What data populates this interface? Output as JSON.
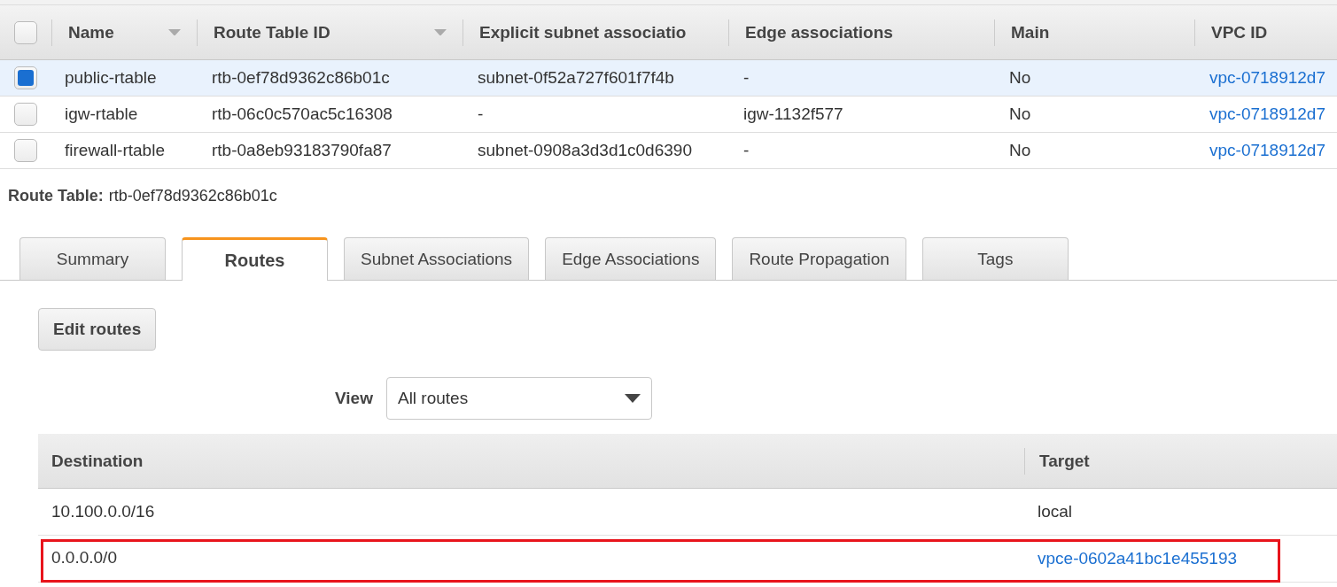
{
  "route_tables": {
    "select_all": {
      "checked": false
    },
    "columns": [
      {
        "label": "Name",
        "sortable": true
      },
      {
        "label": "Route Table ID",
        "sortable": true
      },
      {
        "label": "Explicit subnet associatio",
        "sortable": false
      },
      {
        "label": "Edge associations",
        "sortable": false
      },
      {
        "label": "Main",
        "sortable": false
      },
      {
        "label": "VPC ID",
        "sortable": false
      }
    ],
    "rows": [
      {
        "selected": true,
        "cells": [
          "public-rtable",
          "rtb-0ef78d9362c86b01c",
          "subnet-0f52a727f601f7f4b",
          "-",
          "No",
          "vpc-0718912d7"
        ]
      },
      {
        "selected": false,
        "cells": [
          "igw-rtable",
          "rtb-06c0c570ac5c16308",
          "-",
          "igw-1132f577",
          "No",
          "vpc-0718912d7"
        ]
      },
      {
        "selected": false,
        "cells": [
          "firewall-rtable",
          "rtb-0a8eb93183790fa87",
          "subnet-0908a3d3d1c0d6390",
          "-",
          "No",
          "vpc-0718912d7"
        ]
      }
    ]
  },
  "detail": {
    "label": "Route Table:",
    "value": "rtb-0ef78d9362c86b01c"
  },
  "tabs": [
    {
      "label": "Summary",
      "selected": false
    },
    {
      "label": "Routes",
      "selected": true
    },
    {
      "label": "Subnet Associations",
      "selected": false
    },
    {
      "label": "Edge Associations",
      "selected": false
    },
    {
      "label": "Route Propagation",
      "selected": false
    },
    {
      "label": "Tags",
      "selected": false
    }
  ],
  "edit_button": "Edit routes",
  "view": {
    "label": "View",
    "value": "All routes"
  },
  "routes": {
    "columns": [
      "Destination",
      "Target"
    ],
    "rows": [
      {
        "destination": "10.100.0.0/16",
        "target": "local",
        "target_link": false,
        "highlighted": false
      },
      {
        "destination": "0.0.0.0/0",
        "target": "vpce-0602a41bc1e455193",
        "target_link": true,
        "highlighted": true
      }
    ]
  }
}
